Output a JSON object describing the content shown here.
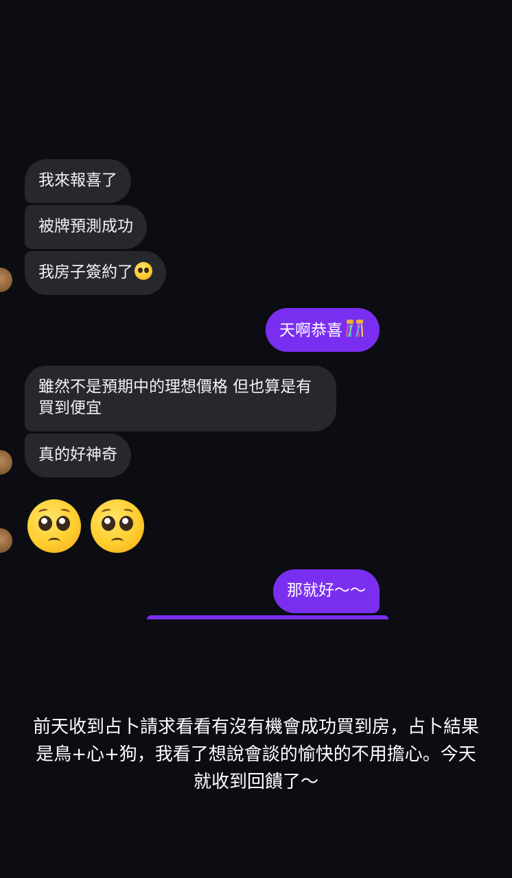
{
  "messages": {
    "m1": "我來報喜了",
    "m2": "被牌預測成功",
    "m3": "我房子簽約了",
    "m4": "天啊恭喜",
    "m5": "雖然不是預期中的理想價格 但也算是有買到便宜",
    "m6": "真的好神奇",
    "m7": "那就好～～"
  },
  "icons": {
    "m3_emoji": "pleading-face",
    "m4_emoji": "confetti-ball",
    "big_emojis": [
      "pleading-face",
      "pleading-face"
    ]
  },
  "colors": {
    "background": "#0b0d12",
    "incoming_bubble": "#26282e",
    "outgoing_bubble": "#7a2ff0"
  },
  "caption": "前天收到占卜請求看看有沒有機會成功買到房，占卜結果是鳥+心+狗，我看了想說會談的愉快的不用擔心。今天就收到回饋了～"
}
